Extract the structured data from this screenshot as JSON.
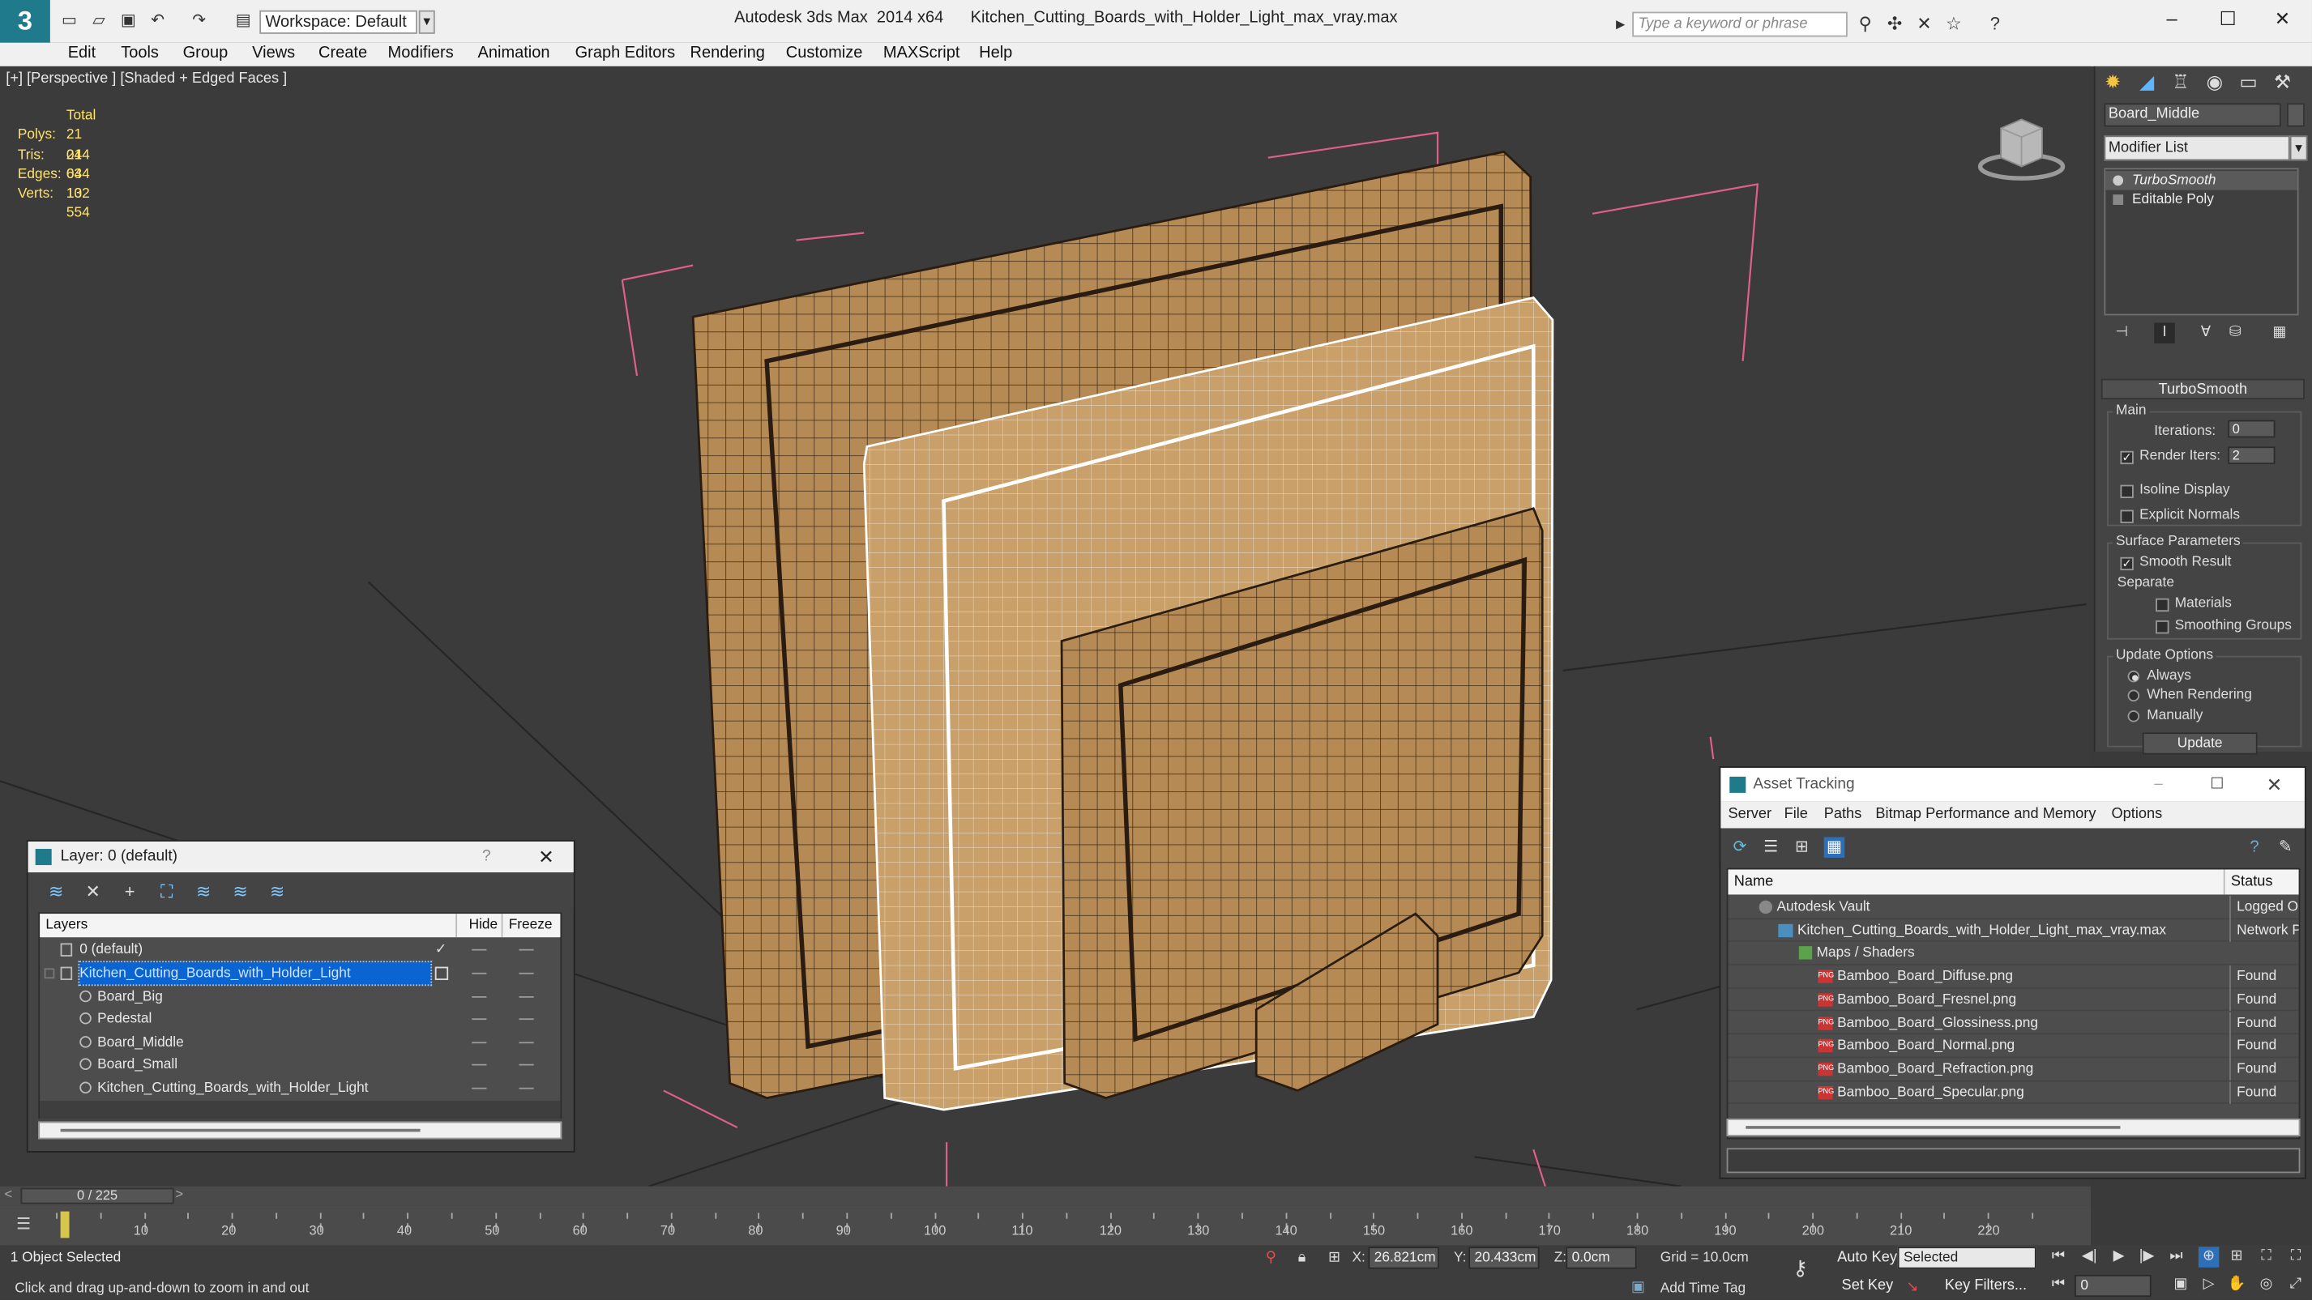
{
  "titlebar": {
    "workspace": "Workspace: Default",
    "title": "Autodesk 3ds Max  2014 x64      Kitchen_Cutting_Boards_with_Holder_Light_max_vray.max",
    "search_placeholder": "Type a keyword or phrase"
  },
  "menu": [
    "Edit",
    "Tools",
    "Group",
    "Views",
    "Create",
    "Modifiers",
    "Animation",
    "Graph Editors",
    "Rendering",
    "Customize",
    "MAXScript",
    "Help"
  ],
  "viewport": {
    "label": "[+] [Perspective ] [Shaded + Edged Faces ]",
    "stats": {
      "header": "Total",
      "rows": [
        {
          "k": "Polys:",
          "v": "21 044"
        },
        {
          "k": "Tris:",
          "v": "21 044"
        },
        {
          "k": "Edges:",
          "v": "63 132"
        },
        {
          "k": "Verts:",
          "v": "10 554"
        }
      ]
    }
  },
  "command_panel": {
    "object_name": "Board_Middle",
    "modifier_list": "Modifier List",
    "stack": [
      "TurboSmooth",
      "Editable Poly"
    ],
    "rollout_title": "TurboSmooth",
    "main_label": "Main",
    "iterations_label": "Iterations:",
    "iterations_value": "0",
    "render_iters_label": "Render Iters:",
    "render_iters_value": "2",
    "isoline": "Isoline Display",
    "explicit": "Explicit Normals",
    "surface_params": "Surface Parameters",
    "smooth_result": "Smooth Result",
    "separate": "Separate",
    "materials": "Materials",
    "smoothing_groups": "Smoothing Groups",
    "update_options": "Update Options",
    "always": "Always",
    "when_rendering": "When Rendering",
    "manually": "Manually",
    "update_button": "Update"
  },
  "layer_dialog": {
    "title": "Layer: 0 (default)",
    "help": "?",
    "columns": {
      "layers": "Layers",
      "hide": "Hide",
      "freeze": "Freeze"
    },
    "rows": [
      {
        "name": "0 (default)",
        "indent": 0
      },
      {
        "name": "Kitchen_Cutting_Boards_with_Holder_Light",
        "indent": 0,
        "selected": true
      },
      {
        "name": "Board_Big",
        "indent": 1
      },
      {
        "name": "Pedestal",
        "indent": 1
      },
      {
        "name": "Board_Middle",
        "indent": 1
      },
      {
        "name": "Board_Small",
        "indent": 1
      },
      {
        "name": "Kitchen_Cutting_Boards_with_Holder_Light",
        "indent": 1
      }
    ]
  },
  "asset_dialog": {
    "title": "Asset Tracking",
    "menu": [
      "Server",
      "File",
      "Paths",
      "Bitmap Performance and Memory",
      "Options"
    ],
    "columns": {
      "name": "Name",
      "status": "Status"
    },
    "rows": [
      {
        "name": "Autodesk Vault",
        "status": "Logged Ou",
        "indent": 1
      },
      {
        "name": "Kitchen_Cutting_Boards_with_Holder_Light_max_vray.max",
        "status": "Network P",
        "indent": 2
      },
      {
        "name": "Maps / Shaders",
        "status": "",
        "indent": 3
      },
      {
        "name": "Bamboo_Board_Diffuse.png",
        "status": "Found",
        "indent": 4
      },
      {
        "name": "Bamboo_Board_Fresnel.png",
        "status": "Found",
        "indent": 4
      },
      {
        "name": "Bamboo_Board_Glossiness.png",
        "status": "Found",
        "indent": 4
      },
      {
        "name": "Bamboo_Board_Normal.png",
        "status": "Found",
        "indent": 4
      },
      {
        "name": "Bamboo_Board_Refraction.png",
        "status": "Found",
        "indent": 4
      },
      {
        "name": "Bamboo_Board_Specular.png",
        "status": "Found",
        "indent": 4
      }
    ]
  },
  "timeline": {
    "frame": "0 / 225",
    "ticks": [
      "10",
      "20",
      "30",
      "40",
      "50",
      "60",
      "70",
      "80",
      "90",
      "100",
      "110",
      "120",
      "130",
      "140",
      "150",
      "160",
      "170",
      "180",
      "190",
      "200",
      "210",
      "220"
    ]
  },
  "status": {
    "selection": "1 Object Selected",
    "prompt": "Click and drag up-and-down to zoom in and out",
    "x_label": "X:",
    "x_value": "26.821cm",
    "y_label": "Y:",
    "y_value": "20.433cm",
    "z_label": "Z:",
    "z_value": "0.0cm",
    "grid": "Grid = 10.0cm",
    "add_time_tag": "Add Time Tag",
    "auto_key": "Auto Key",
    "selected": "Selected",
    "set_key": "Set Key",
    "key_filters": "Key Filters...",
    "frame_value": "0"
  },
  "colors": {
    "accent": "#0a64d2",
    "stats": "#ffe36b",
    "found": "#e8e8e8"
  }
}
